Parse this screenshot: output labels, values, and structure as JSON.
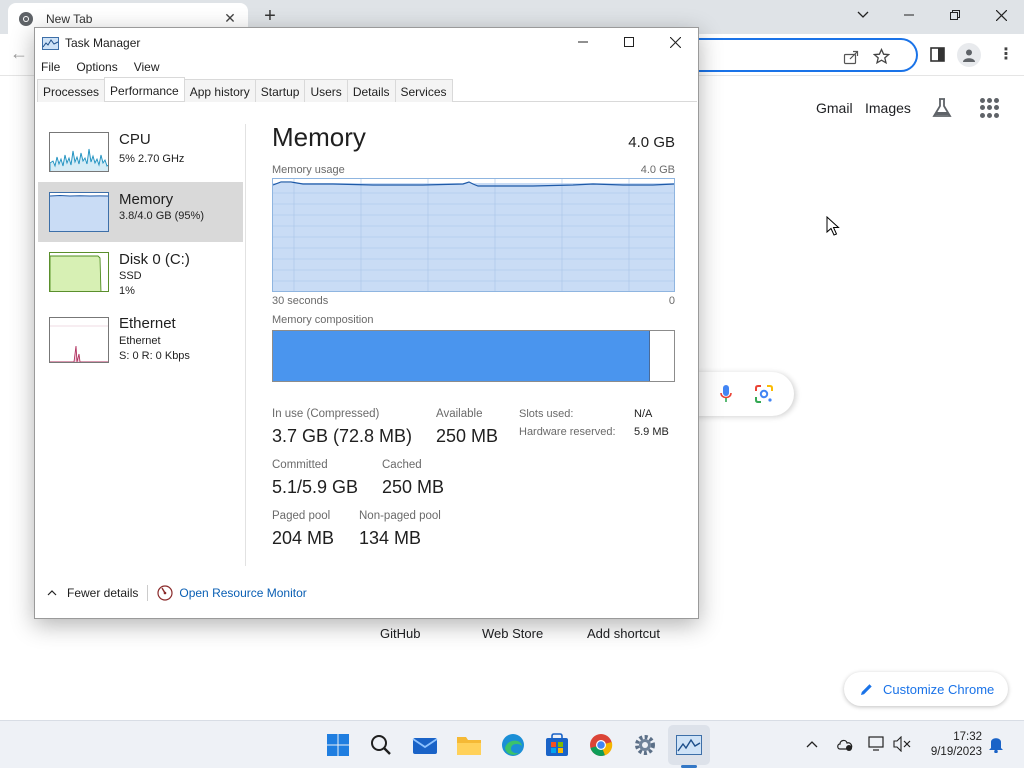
{
  "chrome": {
    "tab_title": "New Tab",
    "links": {
      "gmail": "Gmail",
      "images": "Images"
    },
    "shortcuts": [
      "GitHub",
      "Web Store",
      "Add shortcut"
    ],
    "customize_label": "Customize Chrome"
  },
  "taskmanager": {
    "title": "Task Manager",
    "menu": [
      "File",
      "Options",
      "View"
    ],
    "tabs": [
      "Processes",
      "Performance",
      "App history",
      "Startup",
      "Users",
      "Details",
      "Services"
    ],
    "active_tab": "Performance",
    "resources": [
      {
        "name": "CPU",
        "line1": "5%  2.70 GHz",
        "line2": ""
      },
      {
        "name": "Memory",
        "line1": "3.8/4.0 GB (95%)",
        "line2": ""
      },
      {
        "name": "Disk 0 (C:)",
        "line1": "SSD",
        "line2": "1%"
      },
      {
        "name": "Ethernet",
        "line1": "Ethernet",
        "line2": "S: 0  R: 0 Kbps"
      }
    ],
    "detail": {
      "title": "Memory",
      "total": "4.0 GB",
      "usage_label": "Memory usage",
      "usage_max": "4.0 GB",
      "graph_left": "30 seconds",
      "graph_right": "0",
      "composition_label": "Memory composition",
      "composition_in_use_fraction": 0.94,
      "stats": {
        "in_use_label": "In use (Compressed)",
        "in_use_value": "3.7 GB (72.8 MB)",
        "available_label": "Available",
        "available_value": "250 MB",
        "committed_label": "Committed",
        "committed_value": "5.1/5.9 GB",
        "cached_label": "Cached",
        "cached_value": "250 MB",
        "paged_label": "Paged pool",
        "paged_value": "204 MB",
        "nonpaged_label": "Non-paged pool",
        "nonpaged_value": "134 MB",
        "slots_label": "Slots used:",
        "slots_value": "N/A",
        "hwres_label": "Hardware reserved:",
        "hwres_value": "5.9 MB"
      }
    },
    "footer": {
      "fewer_details": "Fewer details",
      "open_resource_monitor": "Open Resource Monitor"
    }
  },
  "taskbar": {
    "time": "17:32",
    "date": "9/19/2023"
  },
  "colors": {
    "accent": "#1a73e8",
    "memory_graph_fill": "#c9dcf5",
    "memory_graph_line": "#1e5aa8",
    "composition_in_use": "#4a95ee",
    "disk_fill": "#d7f0b4",
    "cpu_line": "#1a8fbf",
    "ethernet_line": "#b0315f"
  }
}
